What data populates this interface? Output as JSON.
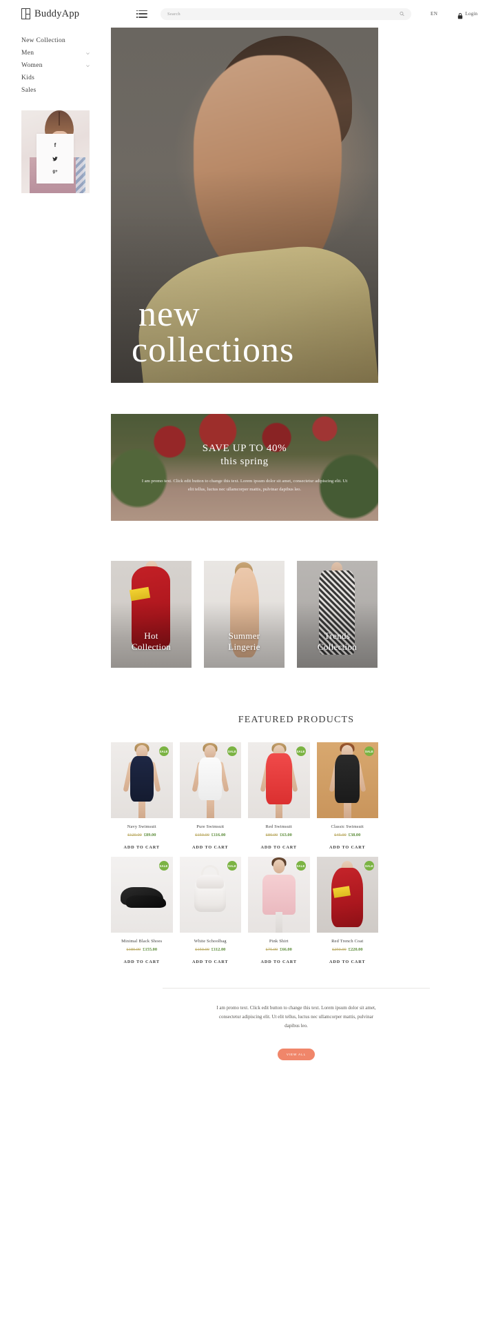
{
  "header": {
    "logo_text": "BuddyApp",
    "menu_icon": "list-menu-icon",
    "search": {
      "placeholder": "Search",
      "value": "",
      "icon": "search-icon"
    },
    "language": "EN",
    "login_label": "Login",
    "lock_icon": "lock-icon"
  },
  "sidebar": {
    "items": [
      {
        "label": "New Collection",
        "has_chevron": false
      },
      {
        "label": "Men",
        "has_chevron": true
      },
      {
        "label": "Women",
        "has_chevron": true
      },
      {
        "label": "Kids",
        "has_chevron": false
      },
      {
        "label": "Sales",
        "has_chevron": false
      }
    ],
    "widget": {
      "socials": [
        {
          "name": "facebook-icon",
          "glyph": "f"
        },
        {
          "name": "twitter-icon",
          "glyph": "•"
        },
        {
          "name": "google-plus-icon",
          "glyph": "g+"
        }
      ]
    }
  },
  "hero": {
    "line1": "new",
    "line2": "collections"
  },
  "promo": {
    "heading_line1": "SAVE UP TO 40%",
    "heading_line2": "this spring",
    "paragraph": "I am promo text. Click edit button to change this text. Lorem ipsum dolor sit amet, consectetur adipiscing elit. Ut elit tellus, luctus nec ullamcorper mattis, pulvinar dapibus leo."
  },
  "categories": [
    {
      "line1": "Hot",
      "line2": "Collection"
    },
    {
      "line1": "Summer",
      "line2": "Lingerie"
    },
    {
      "line1": "Trends",
      "line2": "Collection"
    }
  ],
  "featured": {
    "title": "FEATURED PRODUCTS",
    "badge_label": "SALE",
    "add_to_cart_label": "ADD TO CART",
    "products": [
      {
        "name": "Navy Swimsuit",
        "old_price": "£120.00",
        "new_price": "£89.00",
        "on_sale": true
      },
      {
        "name": "Pure Swimsuit",
        "old_price": "£150.00",
        "new_price": "£116.00",
        "on_sale": true
      },
      {
        "name": "Red Swimsuit",
        "old_price": "£80.00",
        "new_price": "£63.00",
        "on_sale": true
      },
      {
        "name": "Classic Swimsuit",
        "old_price": "£45.00",
        "new_price": "£38.00",
        "on_sale": true
      },
      {
        "name": "Minimal Black Shoes",
        "old_price": "£180.00",
        "new_price": "£155.00",
        "on_sale": true
      },
      {
        "name": "White Schoolbag",
        "old_price": "£150.00",
        "new_price": "£112.00",
        "on_sale": true
      },
      {
        "name": "Pink Shirt",
        "old_price": "£75.00",
        "new_price": "£66.00",
        "on_sale": true
      },
      {
        "name": "Red Trench Coat",
        "old_price": "£250.00",
        "new_price": "£220.00",
        "on_sale": true
      }
    ]
  },
  "footer": {
    "paragraph": "I am promo text. Click edit button to change this text. Lorem ipsum dolor sit amet, consectetur adipiscing elit. Ut elit tellus, luctus nec ullamcorper mattis, pulvinar dapibus leo.",
    "view_all_label": "VIEW ALL",
    "accent_color": "#f0866a"
  }
}
